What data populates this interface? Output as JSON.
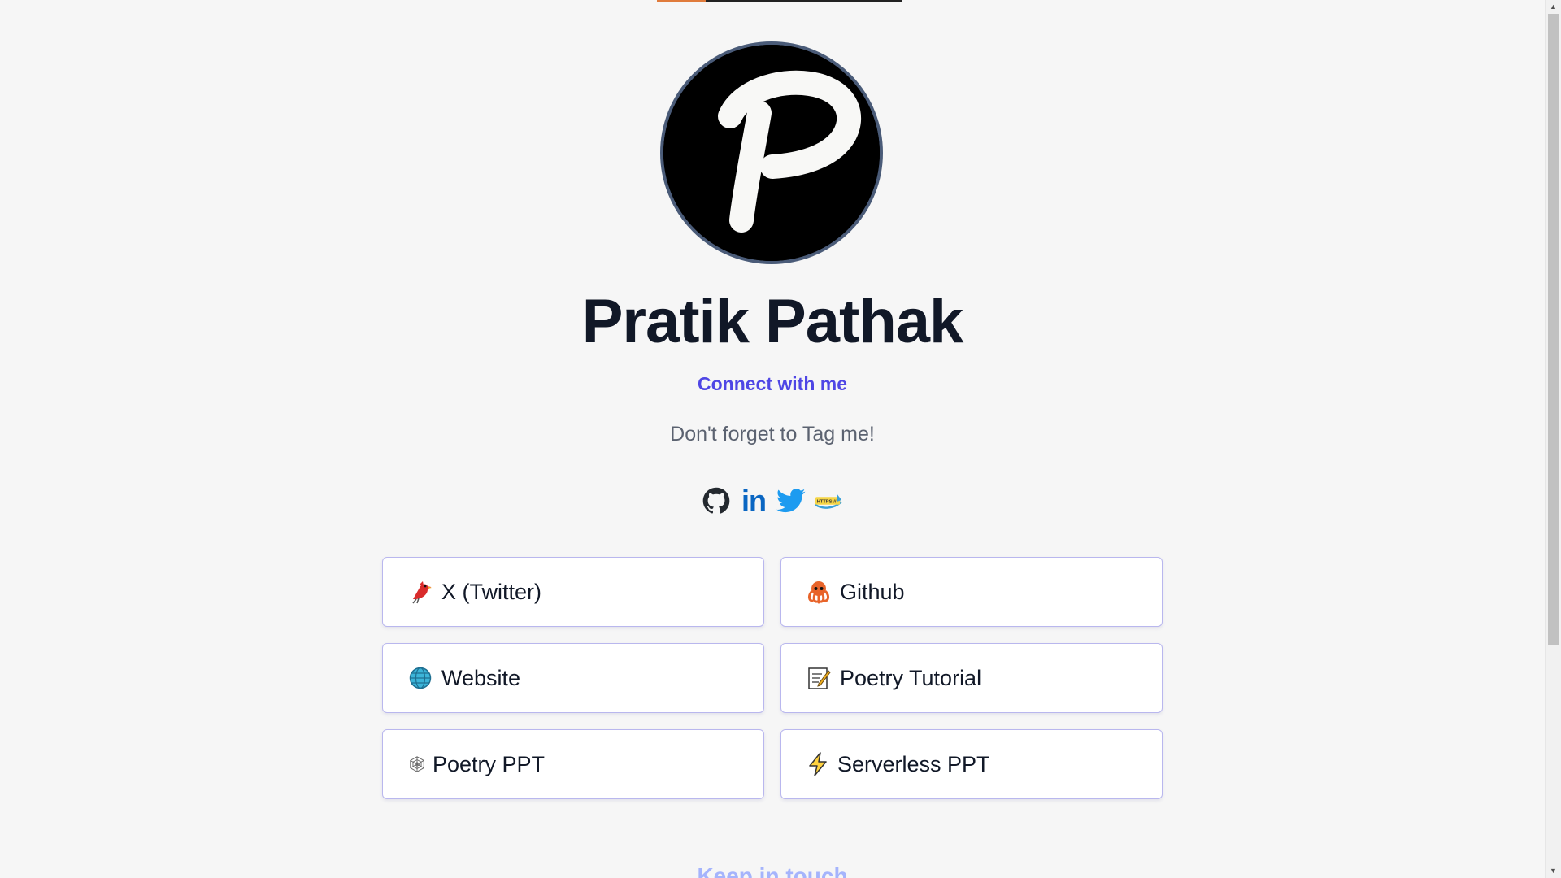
{
  "colors": {
    "background": "#f6f6f6",
    "name_text": "#111827",
    "accent": "#4f46e5",
    "card_border": "#b9b7ee",
    "progress": "#e07b3c",
    "footer_peek": "#a5b4fc"
  },
  "top_progress": {
    "fraction": 0.2
  },
  "profile": {
    "avatar_letter": "P",
    "name": "Pratik Pathak",
    "connect_text": "Connect with me",
    "tagline": "Don't forget to Tag me!"
  },
  "socials": [
    {
      "name": "github",
      "icon": "github-icon"
    },
    {
      "name": "linkedin",
      "icon": "linkedin-icon",
      "label": "in"
    },
    {
      "name": "twitter",
      "icon": "twitter-bird-icon"
    },
    {
      "name": "website",
      "icon": "https-badge-icon",
      "label": "HTTPS://"
    }
  ],
  "links": [
    {
      "label": "X (Twitter)",
      "icon": "red-bird-icon"
    },
    {
      "label": "Github",
      "icon": "octopus-icon"
    },
    {
      "label": "Website",
      "icon": "globe-icon"
    },
    {
      "label": "Poetry Tutorial",
      "icon": "memo-icon"
    },
    {
      "label": "Poetry PPT",
      "icon": "spider-web-icon"
    },
    {
      "label": "Serverless PPT",
      "icon": "lightning-icon"
    }
  ],
  "footer": {
    "heading_peek": "Keep in touch"
  }
}
